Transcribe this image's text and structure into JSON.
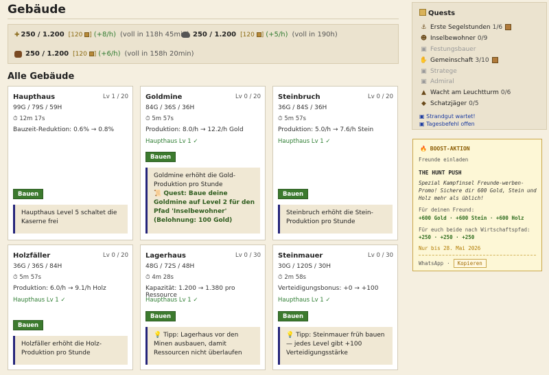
{
  "page": {
    "title": "Gebäude",
    "section_title": "Alle Gebäude"
  },
  "resources": [
    {
      "icon": "gold-plus-icon",
      "glyph": "✚",
      "amount": "250 / 1.200",
      "cap": "[120",
      "rate": "(+8/h)",
      "full": "(voll in 118h 45min)"
    },
    {
      "icon": "stone-icon",
      "glyph": "◆",
      "amount": "250 / 1.200",
      "cap": "[120",
      "rate": "(+5/h)",
      "full": "(voll in 190h)"
    },
    {
      "icon": "wood-icon",
      "glyph": "◆",
      "amount": "250 / 1.200",
      "cap": "[120",
      "rate": "(+6/h)",
      "full": "(voll in 158h 20min)"
    }
  ],
  "build_label": "Bauen",
  "buildings": [
    {
      "name": "Haupthaus",
      "level": "Lv 1 / 20",
      "cost": "99G / 79S / 59H",
      "time": "12m 17s",
      "effect": "Bauzeit-Reduktion: 0.6% → 0.8%",
      "requirement": "",
      "note": "Haupthaus Level 5 schaltet die Kaserne frei",
      "quest": ""
    },
    {
      "name": "Goldmine",
      "level": "Lv 0 / 20",
      "cost": "84G / 36S / 36H",
      "time": "5m 57s",
      "effect": "Produktion: 8.0/h → 12.2/h Gold",
      "requirement": "Haupthaus Lv 1 ✓",
      "note": "Goldmine erhöht die Gold-Produktion pro Stunde",
      "quest": "Quest: Baue deine Goldmine auf Level 2 für den Pfad 'Inselbewohner' (Belohnung: 100 Gold)"
    },
    {
      "name": "Steinbruch",
      "level": "Lv 0 / 20",
      "cost": "36G / 84S / 36H",
      "time": "5m 57s",
      "effect": "Produktion: 5.0/h → 7.6/h Stein",
      "requirement": "Haupthaus Lv 1 ✓",
      "note": "Steinbruch erhöht die Stein-Produktion pro Stunde",
      "quest": ""
    },
    {
      "name": "Holzfäller",
      "level": "Lv 0 / 20",
      "cost": "36G / 36S / 84H",
      "time": "5m 57s",
      "effect": "Produktion: 6.0/h → 9.1/h Holz",
      "requirement": "Haupthaus Lv 1 ✓",
      "note": "Holzfäller erhöht die Holz-Produktion pro Stunde",
      "quest": ""
    },
    {
      "name": "Lagerhaus",
      "level": "Lv 0 / 30",
      "cost": "48G / 72S / 48H",
      "time": "4m 28s",
      "effect": "Kapazität: 1.200 → 1.380 pro Ressource",
      "requirement": "Haupthaus Lv 1 ✓",
      "note": "Tipp: Lagerhaus vor den Minen ausbauen, damit Ressourcen nicht überlaufen",
      "quest": ""
    },
    {
      "name": "Steinmauer",
      "level": "Lv 0 / 30",
      "cost": "30G / 120S / 30H",
      "time": "2m 58s",
      "effect": "Verteidigungsbonus: +0 → +100",
      "requirement": "Haupthaus Lv 1 ✓",
      "note": "Tipp: Steinmauer früh bauen — jedes Level gibt +100 Verteidigungsstärke",
      "quest": ""
    }
  ],
  "quests": {
    "title": "Quests",
    "items": [
      {
        "icon": "anchor-icon",
        "glyph": "⚓",
        "label": "Erste Segelstunden",
        "progress": "1/6",
        "dim": false,
        "reward": true
      },
      {
        "icon": "person-icon",
        "glyph": "☻",
        "label": "Inselbewohner",
        "progress": "0/9",
        "dim": false,
        "reward": false
      },
      {
        "icon": "lock-icon",
        "glyph": "▣",
        "label": "Festungsbauer",
        "progress": "",
        "dim": true,
        "reward": false
      },
      {
        "icon": "handshake-icon",
        "glyph": "✋",
        "label": "Gemeinschaft",
        "progress": "3/10",
        "dim": false,
        "reward": true
      },
      {
        "icon": "lock-icon",
        "glyph": "▣",
        "label": "Stratege",
        "progress": "",
        "dim": true,
        "reward": false
      },
      {
        "icon": "lock-icon",
        "glyph": "▣",
        "label": "Admiral",
        "progress": "",
        "dim": true,
        "reward": false
      },
      {
        "icon": "lighthouse-icon",
        "glyph": "▲",
        "label": "Wacht am Leuchtturm",
        "progress": "0/6",
        "dim": false,
        "reward": false
      },
      {
        "icon": "gem-icon",
        "glyph": "◆",
        "label": "Schatzjäger",
        "progress": "0/5",
        "dim": false,
        "reward": false
      }
    ],
    "links": [
      "Strandgut wartet!",
      "Tagesbefehl offen"
    ]
  },
  "boost": {
    "title": "BOOST-AKTION",
    "subtitle": "Freunde einladen",
    "headline": "THE HUNT PUSH",
    "description": "Spezial Kampfinsel Freunde-werben-Promo! Sichere dir 600 Gold, Stein und Holz mehr als üblich!",
    "friend_label": "Für deinen Freund:",
    "friend_reward": "+600 Gold · +600 Stein · +600 Holz",
    "both_label": "Für euch beide nach Wirtschaftspfad:",
    "both_reward": "+250 · +250 · +250",
    "until": "Nur bis 28. Mai 2026",
    "share": "WhatsApp",
    "sep": "·",
    "copy": "Kopieren"
  }
}
